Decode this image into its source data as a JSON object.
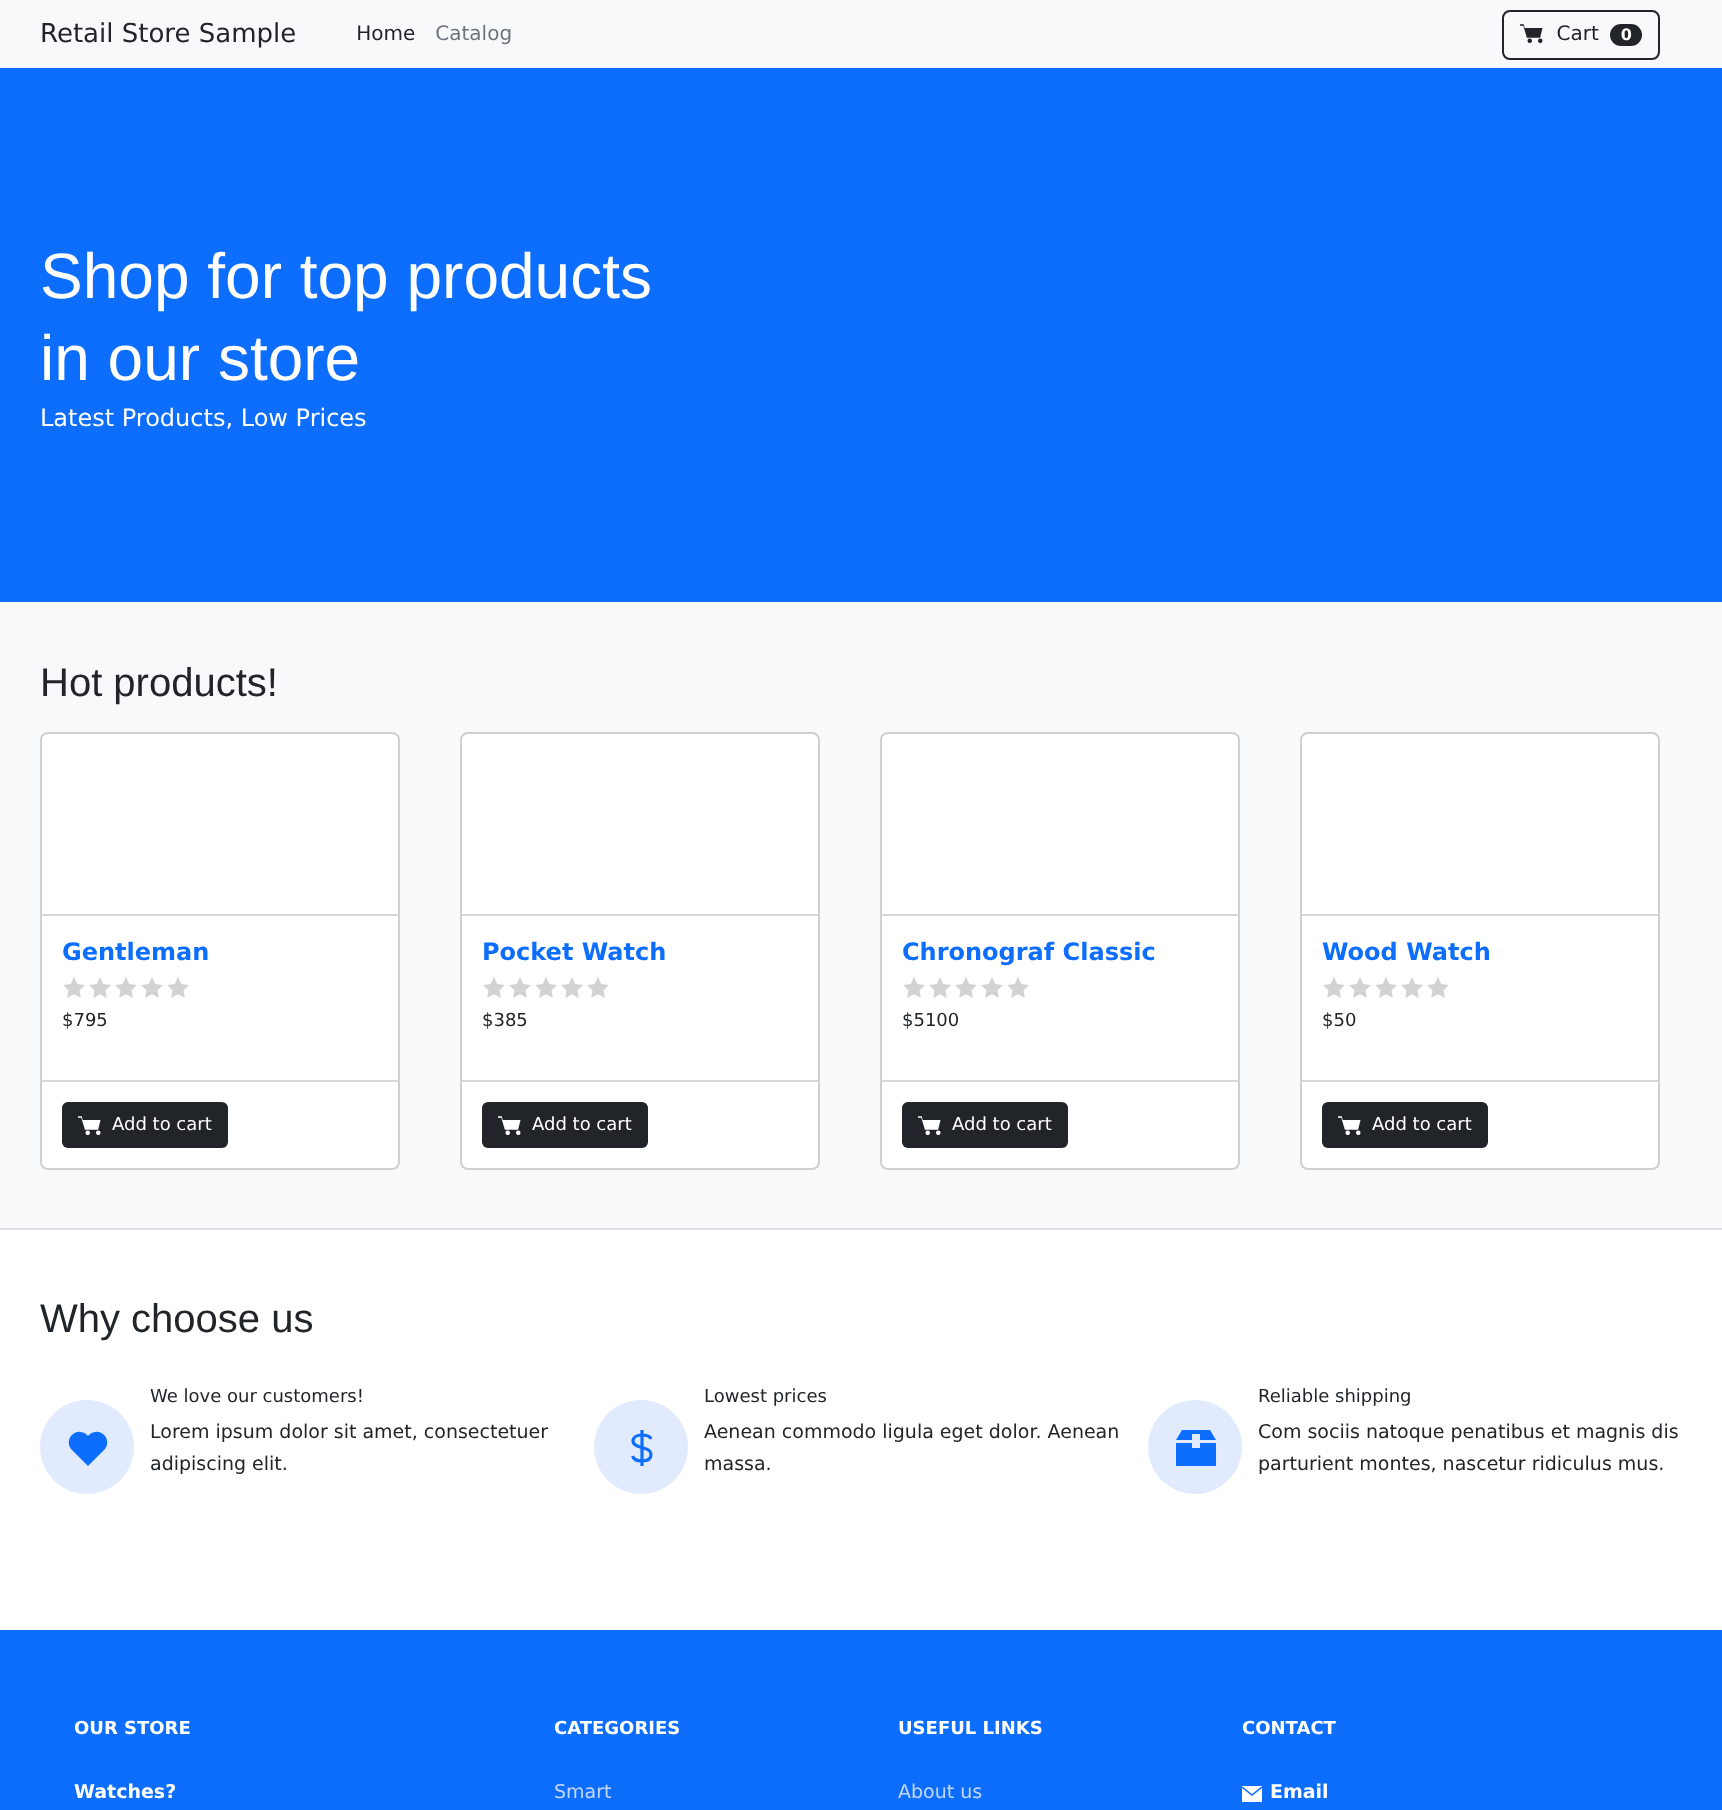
{
  "navbar": {
    "brand": "Retail Store Sample",
    "links": [
      {
        "label": "Home",
        "selected": true
      },
      {
        "label": "Catalog",
        "selected": false
      }
    ],
    "cart": {
      "label": "Cart",
      "count": "0"
    }
  },
  "hero": {
    "title_lines": [
      "Shop for top products",
      "in our store"
    ],
    "subtitle": "Latest Products, Low Prices"
  },
  "hot_products": {
    "title": "Hot products!",
    "products": [
      {
        "name": "Gentleman",
        "stars": 0,
        "price": "$795",
        "button": "Add to cart"
      },
      {
        "name": "Pocket Watch",
        "stars": 0,
        "price": "$385",
        "button": "Add to cart"
      },
      {
        "name": "Chronograf Classic",
        "stars": 0,
        "price": "$5100",
        "button": "Add to cart"
      },
      {
        "name": "Wood Watch",
        "stars": 0,
        "price": "$50",
        "button": "Add to cart"
      }
    ]
  },
  "why_choose": {
    "title": "Why choose us",
    "features": [
      {
        "kind": "heart",
        "title": "We love our customers!",
        "text": "Lorem ipsum dolor sit amet, consectetuer adipiscing elit."
      },
      {
        "kind": "dollar",
        "title": "Lowest prices",
        "text": "Aenean commodo ligula eget dolor. Aenean massa."
      },
      {
        "kind": "box",
        "title": "Reliable shipping",
        "text": "Com sociis natoque penatibus et magnis dis parturient montes, nascetur ridiculus mus."
      }
    ]
  },
  "footer": {
    "columns": [
      {
        "title": "OUR STORE",
        "links": [
          {
            "label": "Watches?",
            "strong": true
          }
        ]
      },
      {
        "title": "CATEGORIES",
        "links": [
          {
            "label": "Smart",
            "strong": false
          }
        ]
      },
      {
        "title": "USEFUL LINKS",
        "links": [
          {
            "label": "About us",
            "strong": false
          }
        ]
      },
      {
        "title": "CONTACT",
        "links": [
          {
            "label": "Email",
            "strong": true,
            "kind": "mail"
          }
        ]
      }
    ]
  }
}
